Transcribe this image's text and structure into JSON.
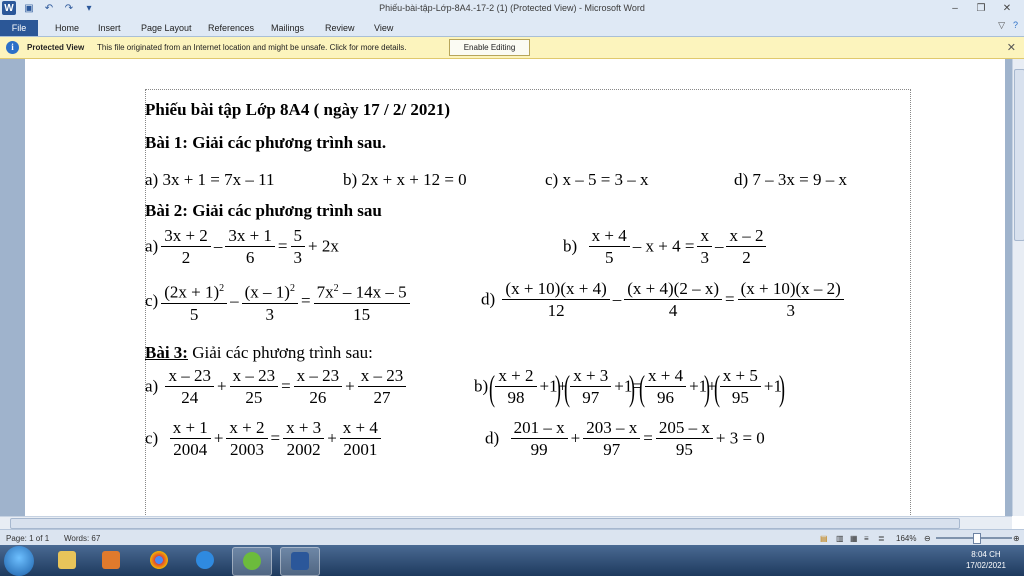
{
  "window": {
    "title": "Phiếu-bài-tập-Lớp-8A4.-17-2 (1) (Protected View)  -  Microsoft Word",
    "controls": [
      "–",
      "❐",
      "✕"
    ]
  },
  "ribbon": {
    "tabs": [
      "File",
      "Home",
      "Insert",
      "Page Layout",
      "References",
      "Mailings",
      "Review",
      "View"
    ]
  },
  "infobar": {
    "title": "Protected View",
    "message": "This file originated from an Internet location and might be unsafe. Click for more details.",
    "button": "Enable Editing"
  },
  "document": {
    "heading": "Phiếu bài tập Lớp 8A4 ( ngày 17 / 2/ 2021)",
    "bai1": "Bài 1: Giải các phương trình sau.",
    "bai1_eqs": [
      "a)  3x + 1 = 7x – 11",
      "b) 2x + x + 12 = 0",
      "c)  x – 5 = 3 – x",
      "d)  7 – 3x = 9 – x"
    ],
    "bai2": "Bài 2: Giải các phương trình sau",
    "bai3_label": "Bài 3:",
    "bai3_text": " Giải các phương trình sau:"
  },
  "status": {
    "page": "Page: 1 of 1",
    "words": "Words: 67",
    "zoom": "164%"
  },
  "taskbar": {
    "time": "8:04 CH",
    "date": "17/02/2021"
  }
}
